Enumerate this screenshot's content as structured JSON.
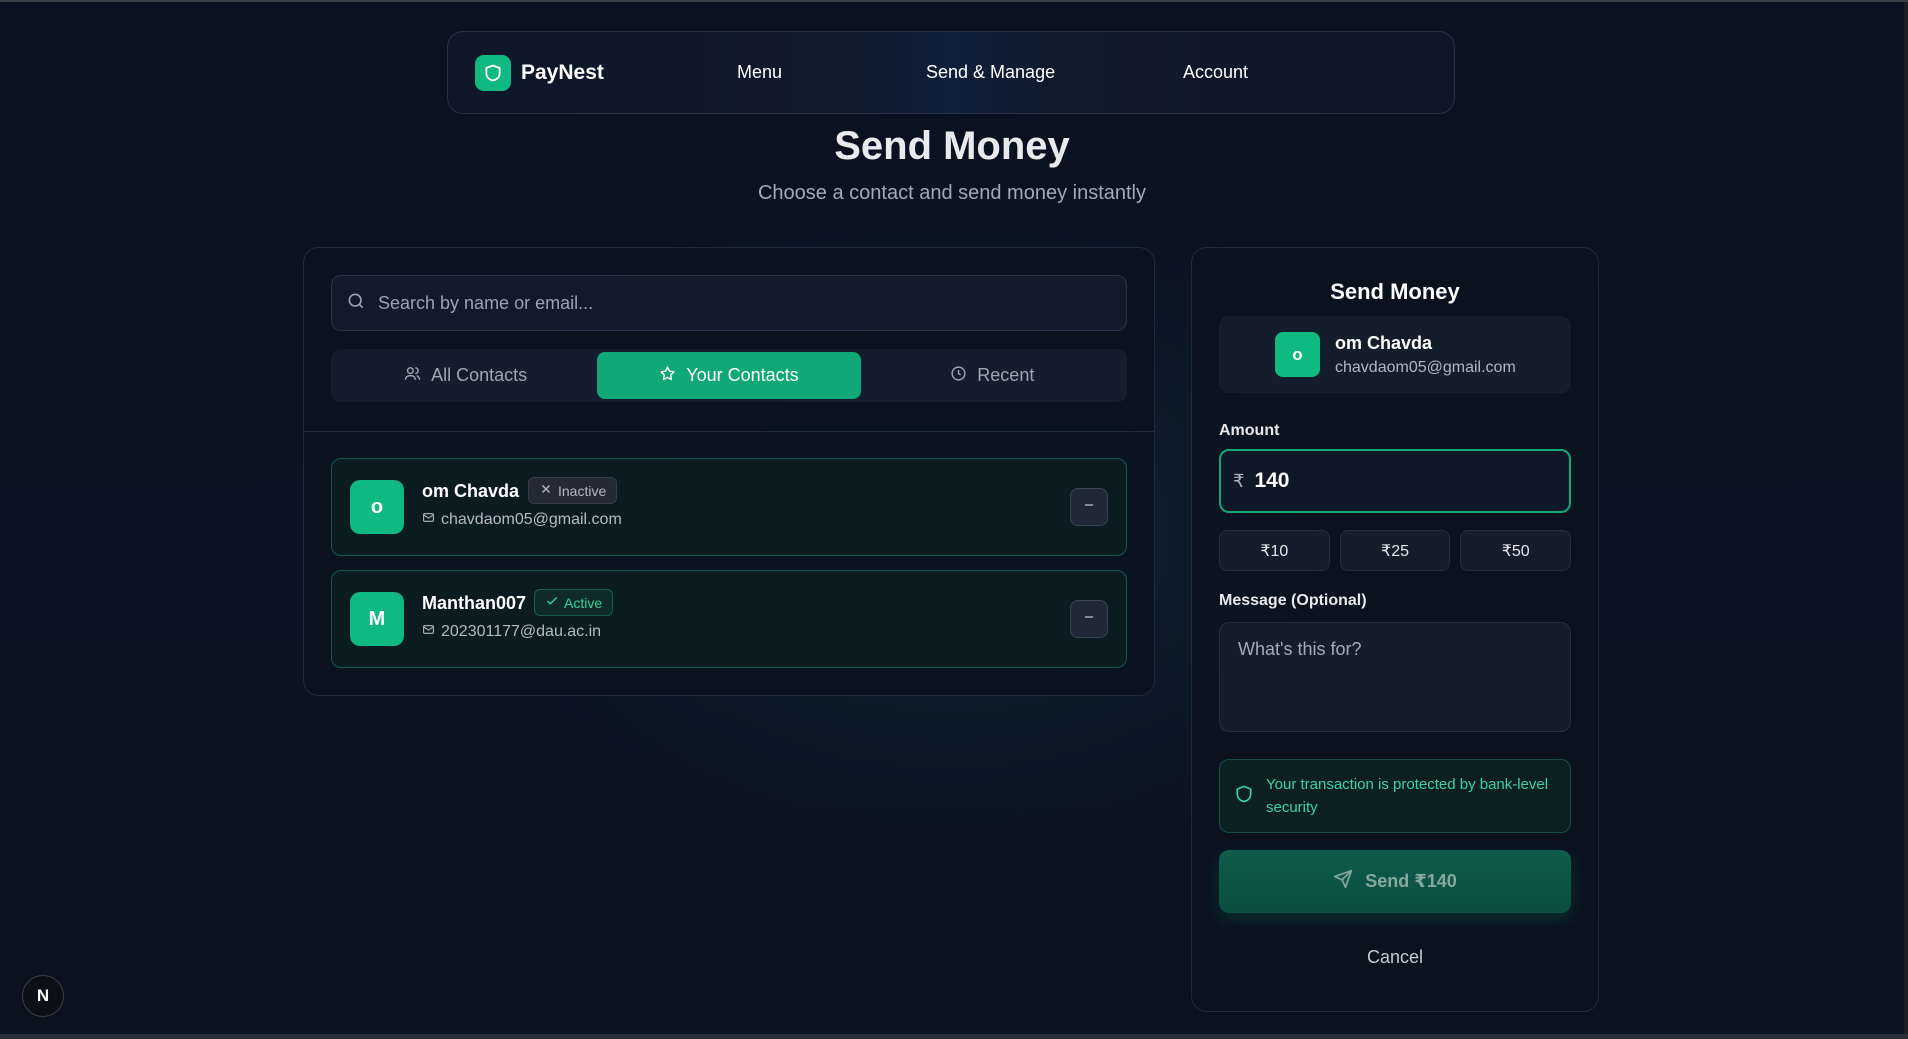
{
  "navbar": {
    "brand": "PayNest",
    "links": [
      "Menu",
      "Send & Manage",
      "Account"
    ]
  },
  "page": {
    "title": "Send Money",
    "subtitle": "Choose a contact and send money instantly"
  },
  "search": {
    "placeholder": "Search by name or email...",
    "value": ""
  },
  "tabs": [
    {
      "label": "All Contacts",
      "icon": "users-icon",
      "active": false
    },
    {
      "label": "Your Contacts",
      "icon": "star-icon",
      "active": true
    },
    {
      "label": "Recent",
      "icon": "clock-icon",
      "active": false
    }
  ],
  "contacts": [
    {
      "initial": "o",
      "name": "om Chavda",
      "status": "Inactive",
      "email": "chavdaom05@gmail.com"
    },
    {
      "initial": "M",
      "name": "Manthan007",
      "status": "Active",
      "email": "202301177@dau.ac.in"
    }
  ],
  "send_panel": {
    "title": "Send Money",
    "recipient": {
      "initial": "o",
      "name": "om Chavda",
      "email": "chavdaom05@gmail.com"
    },
    "amount_label": "Amount",
    "currency_symbol": "₹",
    "amount_value": "140",
    "quick_amounts": [
      "₹10",
      "₹25",
      "₹50"
    ],
    "message_label": "Message (Optional)",
    "message_placeholder": "What's this for?",
    "security_note": "Your transaction is protected by bank-level security",
    "send_label": "Send ₹140",
    "cancel_label": "Cancel"
  },
  "corner_badge": "N",
  "colors": {
    "accent": "#10b981",
    "background": "#0b1220",
    "active_tab": "#10a877",
    "success_text": "#34d399"
  }
}
